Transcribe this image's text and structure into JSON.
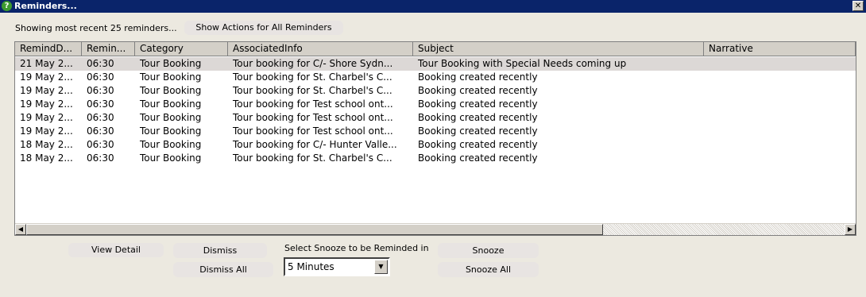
{
  "window": {
    "title": "Reminders..."
  },
  "header": {
    "showing_text": "Showing most recent 25 reminders...",
    "show_actions_label": "Show Actions for All Reminders"
  },
  "grid": {
    "columns": [
      "RemindD...",
      "Remin...",
      "Category",
      "AssociatedInfo",
      "Subject",
      "Narrative"
    ],
    "rows": [
      [
        "21 May 2...",
        "06:30",
        "Tour Booking",
        "Tour booking for C/- Shore Sydn...",
        "Tour Booking with Special Needs coming up",
        ""
      ],
      [
        "19 May 2...",
        "06:30",
        "Tour Booking",
        "Tour booking for St. Charbel's C...",
        "Booking created recently",
        ""
      ],
      [
        "19 May 2...",
        "06:30",
        "Tour Booking",
        "Tour booking for St. Charbel's C...",
        "Booking created recently",
        ""
      ],
      [
        "19 May 2...",
        "06:30",
        "Tour Booking",
        "Tour booking for Test school ont...",
        "Booking created recently",
        ""
      ],
      [
        "19 May 2...",
        "06:30",
        "Tour Booking",
        "Tour booking for Test school ont...",
        "Booking created recently",
        ""
      ],
      [
        "19 May 2...",
        "06:30",
        "Tour Booking",
        "Tour booking for Test school ont...",
        "Booking created recently",
        ""
      ],
      [
        "18 May 2...",
        "06:30",
        "Tour Booking",
        "Tour booking for C/- Hunter Valle...",
        "Booking created recently",
        ""
      ],
      [
        "18 May 2...",
        "06:30",
        "Tour Booking",
        "Tour booking for St. Charbel's C...",
        "Booking created recently",
        ""
      ]
    ],
    "selected_row": 0
  },
  "actions": {
    "view_detail": "View Detail",
    "dismiss": "Dismiss",
    "dismiss_all": "Dismiss All",
    "snooze_label": "Select Snooze to be Reminded in",
    "snooze_value": "5 Minutes",
    "snooze": "Snooze",
    "snooze_all": "Snooze All"
  },
  "icons": {
    "title_icon": "help-question-icon",
    "close_icon": "close-icon",
    "scroll_left": "arrow-left-icon",
    "scroll_right": "arrow-right-icon",
    "dropdown": "chevron-down-icon"
  },
  "colors": {
    "titlebar": "#0a246a",
    "window_bg": "#ece9e0",
    "selected_row": "#dcd8d6"
  }
}
